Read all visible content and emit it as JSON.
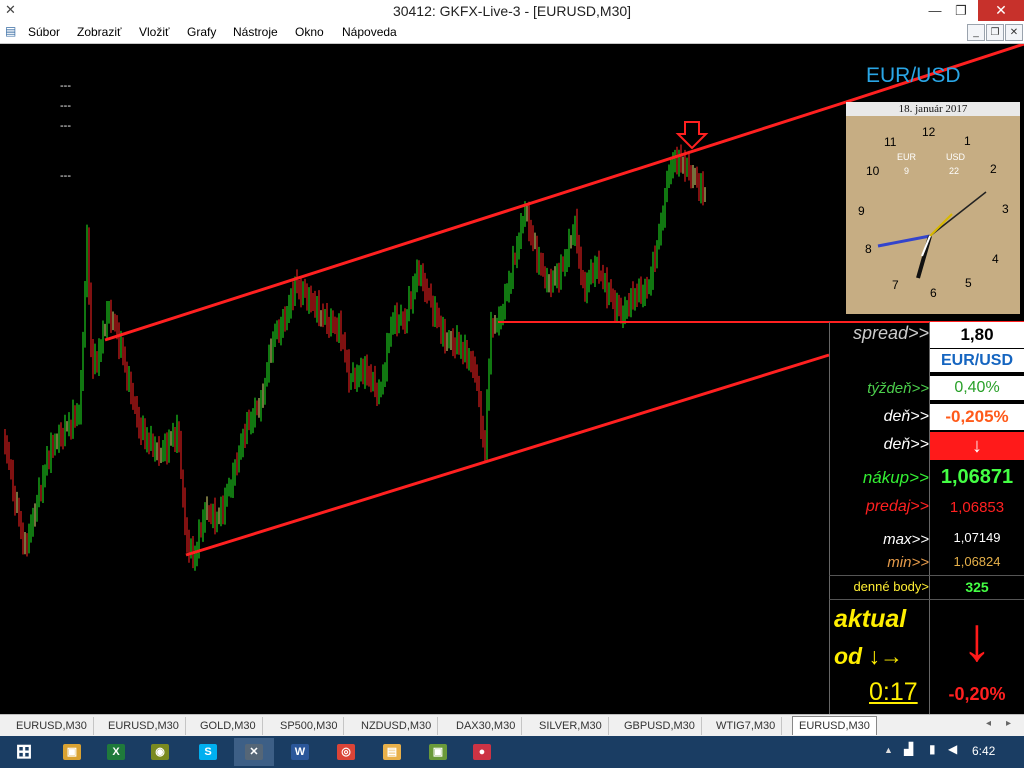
{
  "window": {
    "title": "30412: GKFX-Live-3 - [EURUSD,M30]",
    "minimize_glyph": "—",
    "maximize_glyph": "❐",
    "close_glyph": "✕"
  },
  "menu": [
    "Súbor",
    "Zobraziť",
    "Vložiť",
    "Grafy",
    "Nástroje",
    "Okno",
    "Nápoveda"
  ],
  "chart": {
    "symbol_title": "EUR/USD",
    "dashes": [
      "---",
      "---",
      "---",
      "---"
    ],
    "colors": {
      "up": "#22ee22",
      "down": "#ff2222",
      "doji": "#e8e27a",
      "channel": "#ff2020",
      "title": "#2aa6e6"
    }
  },
  "clock": {
    "date": "18. január 2017",
    "numbers": [
      "12",
      "1",
      "2",
      "3",
      "4",
      "5",
      "6",
      "7",
      "8",
      "9",
      "10",
      "11"
    ],
    "zone_left_label": "EUR",
    "zone_left_value": "9",
    "zone_right_label": "USD",
    "zone_right_value": "22"
  },
  "panel": {
    "spread_label": "spread>>",
    "spread_value": "1,80",
    "pair": "EUR/USD",
    "week_label": "týždeň>>",
    "week_value": "0,40%",
    "day_label": "deň>>",
    "day_value": "-0,205%",
    "day2_label": "deň>>",
    "day2_arrow": "↓",
    "buy_label": "nákup>>",
    "buy_value": "1,06871",
    "sell_label": "predaj>>",
    "sell_value": "1,06853",
    "max_label": "max>>",
    "max_value": "1,07149",
    "min_label": "min>>",
    "min_value": "1,06824",
    "points_label": "denné body>",
    "points_value": "325",
    "aktual": "aktual",
    "od": "od ↓→",
    "timer": "0:17",
    "big_arrow": "↓",
    "change": "-0,20%"
  },
  "tabs": [
    "EURUSD,M30",
    "EURUSD,M30",
    "GOLD,M30",
    "SP500,M30",
    "NZDUSD,M30",
    "DAX30,M30",
    "SILVER,M30",
    "GBPUSD,M30",
    "WTIG7,M30",
    "EURUSD,M30"
  ],
  "active_tab": 9,
  "taskbar": {
    "time": "6:42",
    "tray_up_glyph": "▲",
    "apps": [
      {
        "name": "start",
        "glyph": "⊞",
        "color": "#ffffff"
      },
      {
        "name": "app-1",
        "glyph": "▣",
        "color": "#d9a232"
      },
      {
        "name": "excel",
        "glyph": "X",
        "color": "#1f7a3b"
      },
      {
        "name": "app-3",
        "glyph": "◉",
        "color": "#7a8a20"
      },
      {
        "name": "skype",
        "glyph": "S",
        "color": "#00aff0"
      },
      {
        "name": "mt4",
        "glyph": "✕",
        "color": "#556677"
      },
      {
        "name": "word",
        "glyph": "W",
        "color": "#2b579a"
      },
      {
        "name": "chrome",
        "glyph": "◎",
        "color": "#db4437"
      },
      {
        "name": "explorer",
        "glyph": "▤",
        "color": "#e8b04a"
      },
      {
        "name": "app-9",
        "glyph": "▣",
        "color": "#6a9a3a"
      },
      {
        "name": "app-10",
        "glyph": "●",
        "color": "#cc3344"
      }
    ]
  }
}
